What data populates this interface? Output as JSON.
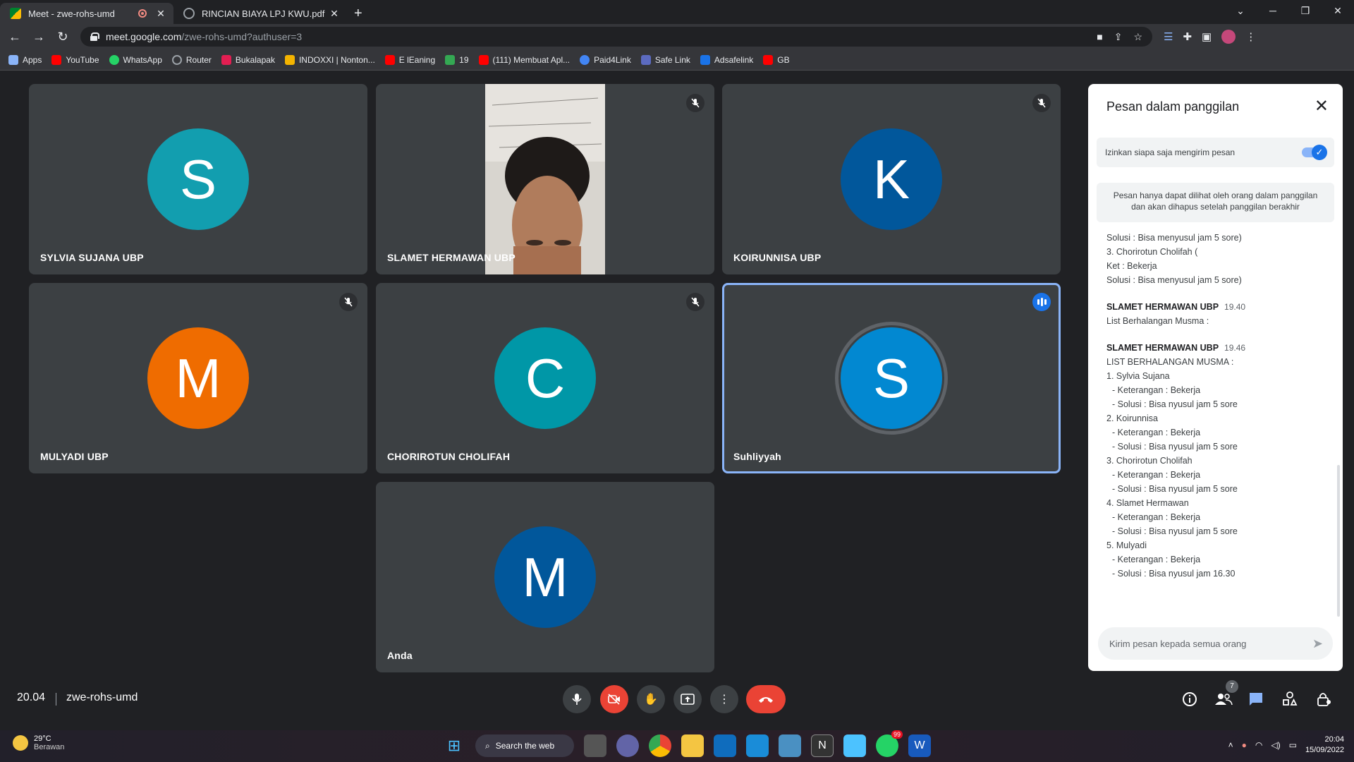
{
  "browser": {
    "tabs": [
      {
        "title": "Meet - zwe-rohs-umd",
        "active": true
      },
      {
        "title": "RINCIAN BIAYA LPJ KWU.pdf",
        "active": false
      }
    ],
    "url_host": "meet.google.com",
    "url_path": "/zwe-rohs-umd?authuser=3",
    "bookmarks": [
      {
        "label": "Apps",
        "icon": "apps-grid-icon",
        "color": "#8ab4f8"
      },
      {
        "label": "YouTube",
        "icon": "youtube-icon",
        "color": "#ff0000"
      },
      {
        "label": "WhatsApp",
        "icon": "whatsapp-icon",
        "color": "#25d366"
      },
      {
        "label": "Router",
        "icon": "globe-icon",
        "color": "#9aa0a6"
      },
      {
        "label": "Bukalapak",
        "icon": "bukalapak-icon",
        "color": "#e31e52"
      },
      {
        "label": "INDOXXI | Nonton...",
        "icon": "indoxxi-icon",
        "color": "#f4b400"
      },
      {
        "label": "E lEaning",
        "icon": "youtube-icon",
        "color": "#ff0000"
      },
      {
        "label": "19",
        "icon": "plus-cross-icon",
        "color": "#34a853"
      },
      {
        "label": "(111) Membuat Apl...",
        "icon": "youtube-icon",
        "color": "#ff0000"
      },
      {
        "label": "Paid4Link",
        "icon": "paid4link-icon",
        "color": "#4285f4"
      },
      {
        "label": "Safe Link",
        "icon": "safelink-icon",
        "color": "#5c6bc0"
      },
      {
        "label": "Adsafelink",
        "icon": "adsafelink-icon",
        "color": "#1a73e8"
      },
      {
        "label": "GB",
        "icon": "youtube-icon",
        "color": "#ff0000"
      }
    ]
  },
  "participants": [
    {
      "name": "SYLVIA SUJANA UBP",
      "initial": "S",
      "color": "#129eaf",
      "muted": false,
      "speaking": false,
      "video": false
    },
    {
      "name": "SLAMET HERMAWAN UBP",
      "initial": "",
      "color": "#d9d6d0",
      "muted": true,
      "speaking": false,
      "video": true
    },
    {
      "name": "KOIRUNNISA UBP",
      "initial": "K",
      "color": "#01579b",
      "muted": true,
      "speaking": false,
      "video": false
    },
    {
      "name": "MULYADI UBP",
      "initial": "M",
      "color": "#ef6c00",
      "muted": true,
      "speaking": false,
      "video": false
    },
    {
      "name": "CHORIROTUN CHOLIFAH",
      "initial": "C",
      "color": "#0097a7",
      "muted": true,
      "speaking": false,
      "video": false
    },
    {
      "name": "Suhliyyah",
      "initial": "S",
      "color": "#0288d1",
      "muted": false,
      "speaking": true,
      "video": false
    },
    {
      "name": "Anda",
      "initial": "M",
      "color": "#01579b",
      "muted": false,
      "speaking": false,
      "video": false
    }
  ],
  "chat": {
    "title": "Pesan dalam panggilan",
    "toggle_label": "Izinkan siapa saja mengirim pesan",
    "toggle_on": true,
    "info": "Pesan hanya dapat dilihat oleh orang dalam panggilan dan akan dihapus setelah panggilan berakhir",
    "earlier_lines": [
      "Solusi : Bisa menyusul jam 5 sore)",
      "3. Chorirotun Cholifah (",
      "Ket : Bekerja",
      "Solusi : Bisa menyusul jam 5 sore)"
    ],
    "messages": [
      {
        "sender": "SLAMET HERMAWAN UBP",
        "time": "19.40",
        "lines": [
          "List Berhalangan Musma :"
        ]
      },
      {
        "sender": "SLAMET HERMAWAN UBP",
        "time": "19.46",
        "lines": [
          "LIST BERHALANGAN MUSMA :",
          "1. Sylvia Sujana",
          "  - Keterangan : Bekerja",
          "  - Solusi : Bisa nyusul jam 5 sore",
          "2. Koirunnisa",
          "  - Keterangan : Bekerja",
          "  - Solusi : Bisa nyusul jam 5 sore",
          "3. Chorirotun Cholifah",
          "  - Keterangan : Bekerja",
          "  - Solusi : Bisa nyusul jam 5 sore",
          "4. Slamet Hermawan",
          "  - Keterangan : Bekerja",
          "  - Solusi : Bisa nyusul jam 5 sore",
          "5. Mulyadi",
          "  - Keterangan : Bekerja",
          "  - Solusi : Bisa nyusul jam 16.30"
        ]
      }
    ],
    "input_placeholder": "Kirim pesan kepada semua orang"
  },
  "meeting": {
    "time": "20.04",
    "code": "zwe-rohs-umd",
    "participant_count": "7"
  },
  "taskbar": {
    "temperature": "29°C",
    "weather": "Berawan",
    "search_label": "Search the web",
    "whatsapp_badge": "99",
    "clock_time": "20:04",
    "clock_date": "15/09/2022"
  }
}
